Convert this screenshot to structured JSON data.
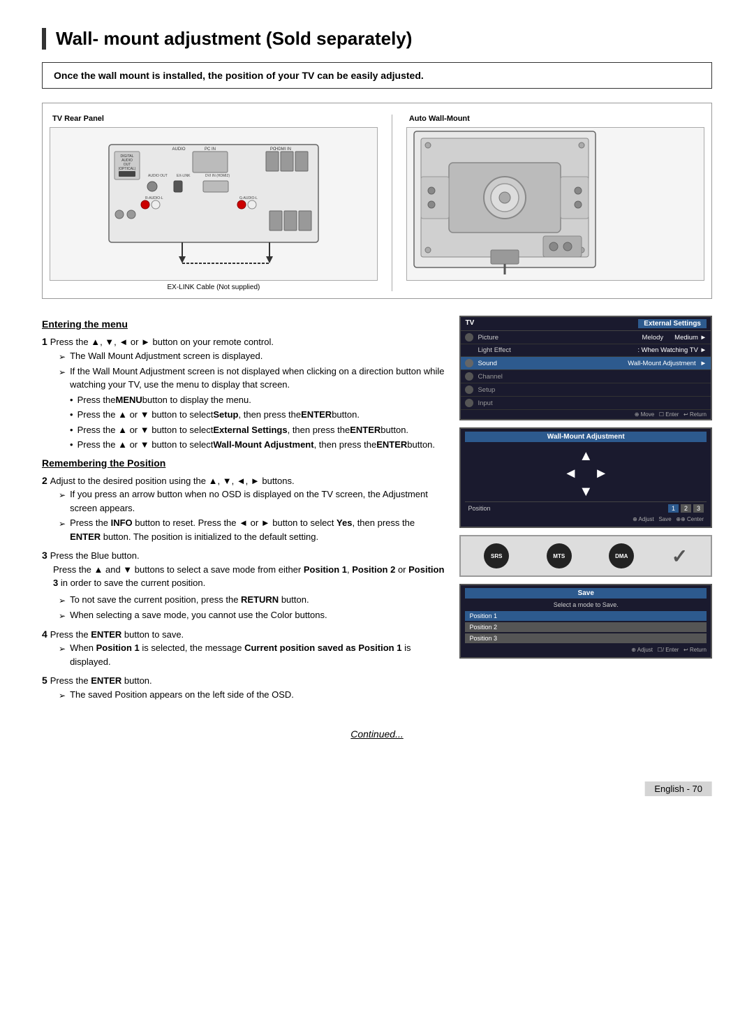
{
  "page": {
    "title": "Wall- mount adjustment (Sold separately)",
    "subtitle": "Once the wall mount is installed, the position of your TV can be easily adjusted.",
    "diagram": {
      "left_label": "TV Rear Panel",
      "right_label": "Auto Wall-Mount",
      "ex_link_label": "EX-LINK Cable (Not supplied)"
    },
    "sections": [
      {
        "heading": "Entering the menu",
        "steps": [
          {
            "number": "1",
            "text": "Press the ▲, ▼, ◄ or ► button on your remote control.",
            "sub_items": [
              {
                "type": "arrow",
                "text": "The Wall Mount Adjustment screen is displayed."
              },
              {
                "type": "arrow",
                "text": "If the Wall Mount Adjustment screen is not displayed when clicking on a direction button while watching your TV, use the menu to display that screen."
              },
              {
                "type": "bullet",
                "text": "Press the MENU button to display the menu."
              },
              {
                "type": "bullet",
                "text": "Press the ▲ or ▼ button to select Setup, then press the ENTER button."
              },
              {
                "type": "bullet",
                "text": "Press the ▲ or ▼ button to select External Settings, then press the ENTER button."
              },
              {
                "type": "bullet",
                "text": "Press the ▲ or ▼ button to select Wall-Mount Adjustment, then press the ENTER button."
              }
            ]
          }
        ]
      },
      {
        "heading": "Remembering the Position",
        "steps": [
          {
            "number": "2",
            "text": "Adjust to the desired position using the ▲, ▼, ◄, ► buttons.",
            "sub_items": [
              {
                "type": "arrow",
                "text": "If you press an arrow button when no OSD is displayed on the TV screen, the Adjustment screen appears."
              },
              {
                "type": "arrow",
                "text": "Press the INFO button to reset. Press the ◄ or ► button to select Yes, then press the ENTER button. The position is initialized to the default setting."
              }
            ]
          },
          {
            "number": "3",
            "text": "Press the Blue button.",
            "extra_text": "Press the ▲ and ▼ buttons to select a save mode from either Position 1, Position 2 or Position 3 in order to save the current position.",
            "sub_items": [
              {
                "type": "arrow",
                "text": "To not save the current position, press the RETURN button."
              },
              {
                "type": "arrow",
                "text": "When selecting a save mode, you cannot use the Color buttons."
              }
            ]
          },
          {
            "number": "4",
            "text": "Press the ENTER button to save.",
            "sub_items": [
              {
                "type": "arrow",
                "text": "When Position 1 is selected, the message Current position saved as Position 1 is displayed."
              }
            ]
          },
          {
            "number": "5",
            "text": "Press the ENTER button.",
            "sub_items": [
              {
                "type": "arrow",
                "text": "The saved Position appears on the left side of the OSD."
              }
            ]
          }
        ]
      }
    ],
    "screenshots": {
      "external_settings": {
        "title": "External Settings",
        "rows": [
          {
            "icon": "picture",
            "label": "Melody",
            "value": "Medium",
            "highlighted": false
          },
          {
            "label": "Light Effect",
            "value": ": When Watching TV ►",
            "highlighted": false
          },
          {
            "icon": "sound",
            "label": "Wall-Mount Adjustment",
            "value": "►",
            "highlighted": true
          },
          {
            "icon": "channel",
            "label": "",
            "value": "",
            "highlighted": false
          },
          {
            "icon": "setup",
            "label": "",
            "value": "",
            "highlighted": false
          },
          {
            "icon": "input",
            "label": "",
            "value": "",
            "highlighted": false
          }
        ],
        "nav_hint": "⊕ Move  ☐ Enter  ↩ Return"
      },
      "wall_mount": {
        "title": "Wall-Mount Adjustment",
        "position_labels": [
          "Position",
          "1",
          "2",
          "3"
        ],
        "hint": "⊕ Adjust   Save  ⊕⊕ Center"
      },
      "buttons": {
        "items": [
          {
            "label": "SRS"
          },
          {
            "label": "MTS"
          },
          {
            "label": "DMA"
          }
        ]
      },
      "save": {
        "title": "Save",
        "subtitle": "Select a mode to Save.",
        "options": [
          {
            "label": "Position 1",
            "active": true
          },
          {
            "label": "Position 2",
            "active": false
          },
          {
            "label": "Position 3",
            "active": false
          }
        ],
        "nav_hint": "⊕ Adjust  ☐/ Enter  ↩ Return"
      }
    },
    "continued": "Continued...",
    "footer": "English - 70"
  }
}
